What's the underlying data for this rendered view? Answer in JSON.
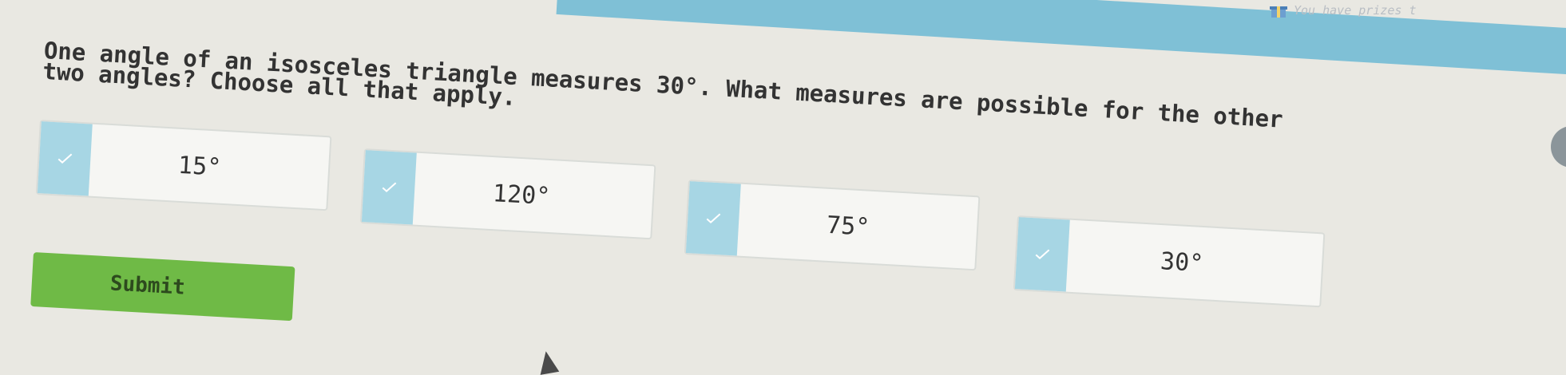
{
  "header": {
    "prize_text": "You have prizes t"
  },
  "question": {
    "line1_prefix": "One angle of an isosceles triangle measures ",
    "given_angle": "30°",
    "line1_suffix": ". What measures are possible for the other",
    "line2": "two angles? Choose all that apply."
  },
  "choices": [
    {
      "label": "15°"
    },
    {
      "label": "120°"
    },
    {
      "label": "75°"
    },
    {
      "label": "30°"
    }
  ],
  "submit_label": "Submit",
  "colors": {
    "accent_band": "#7fc0d6",
    "checkbox": "#a7d6e4",
    "submit": "#6fba46"
  }
}
